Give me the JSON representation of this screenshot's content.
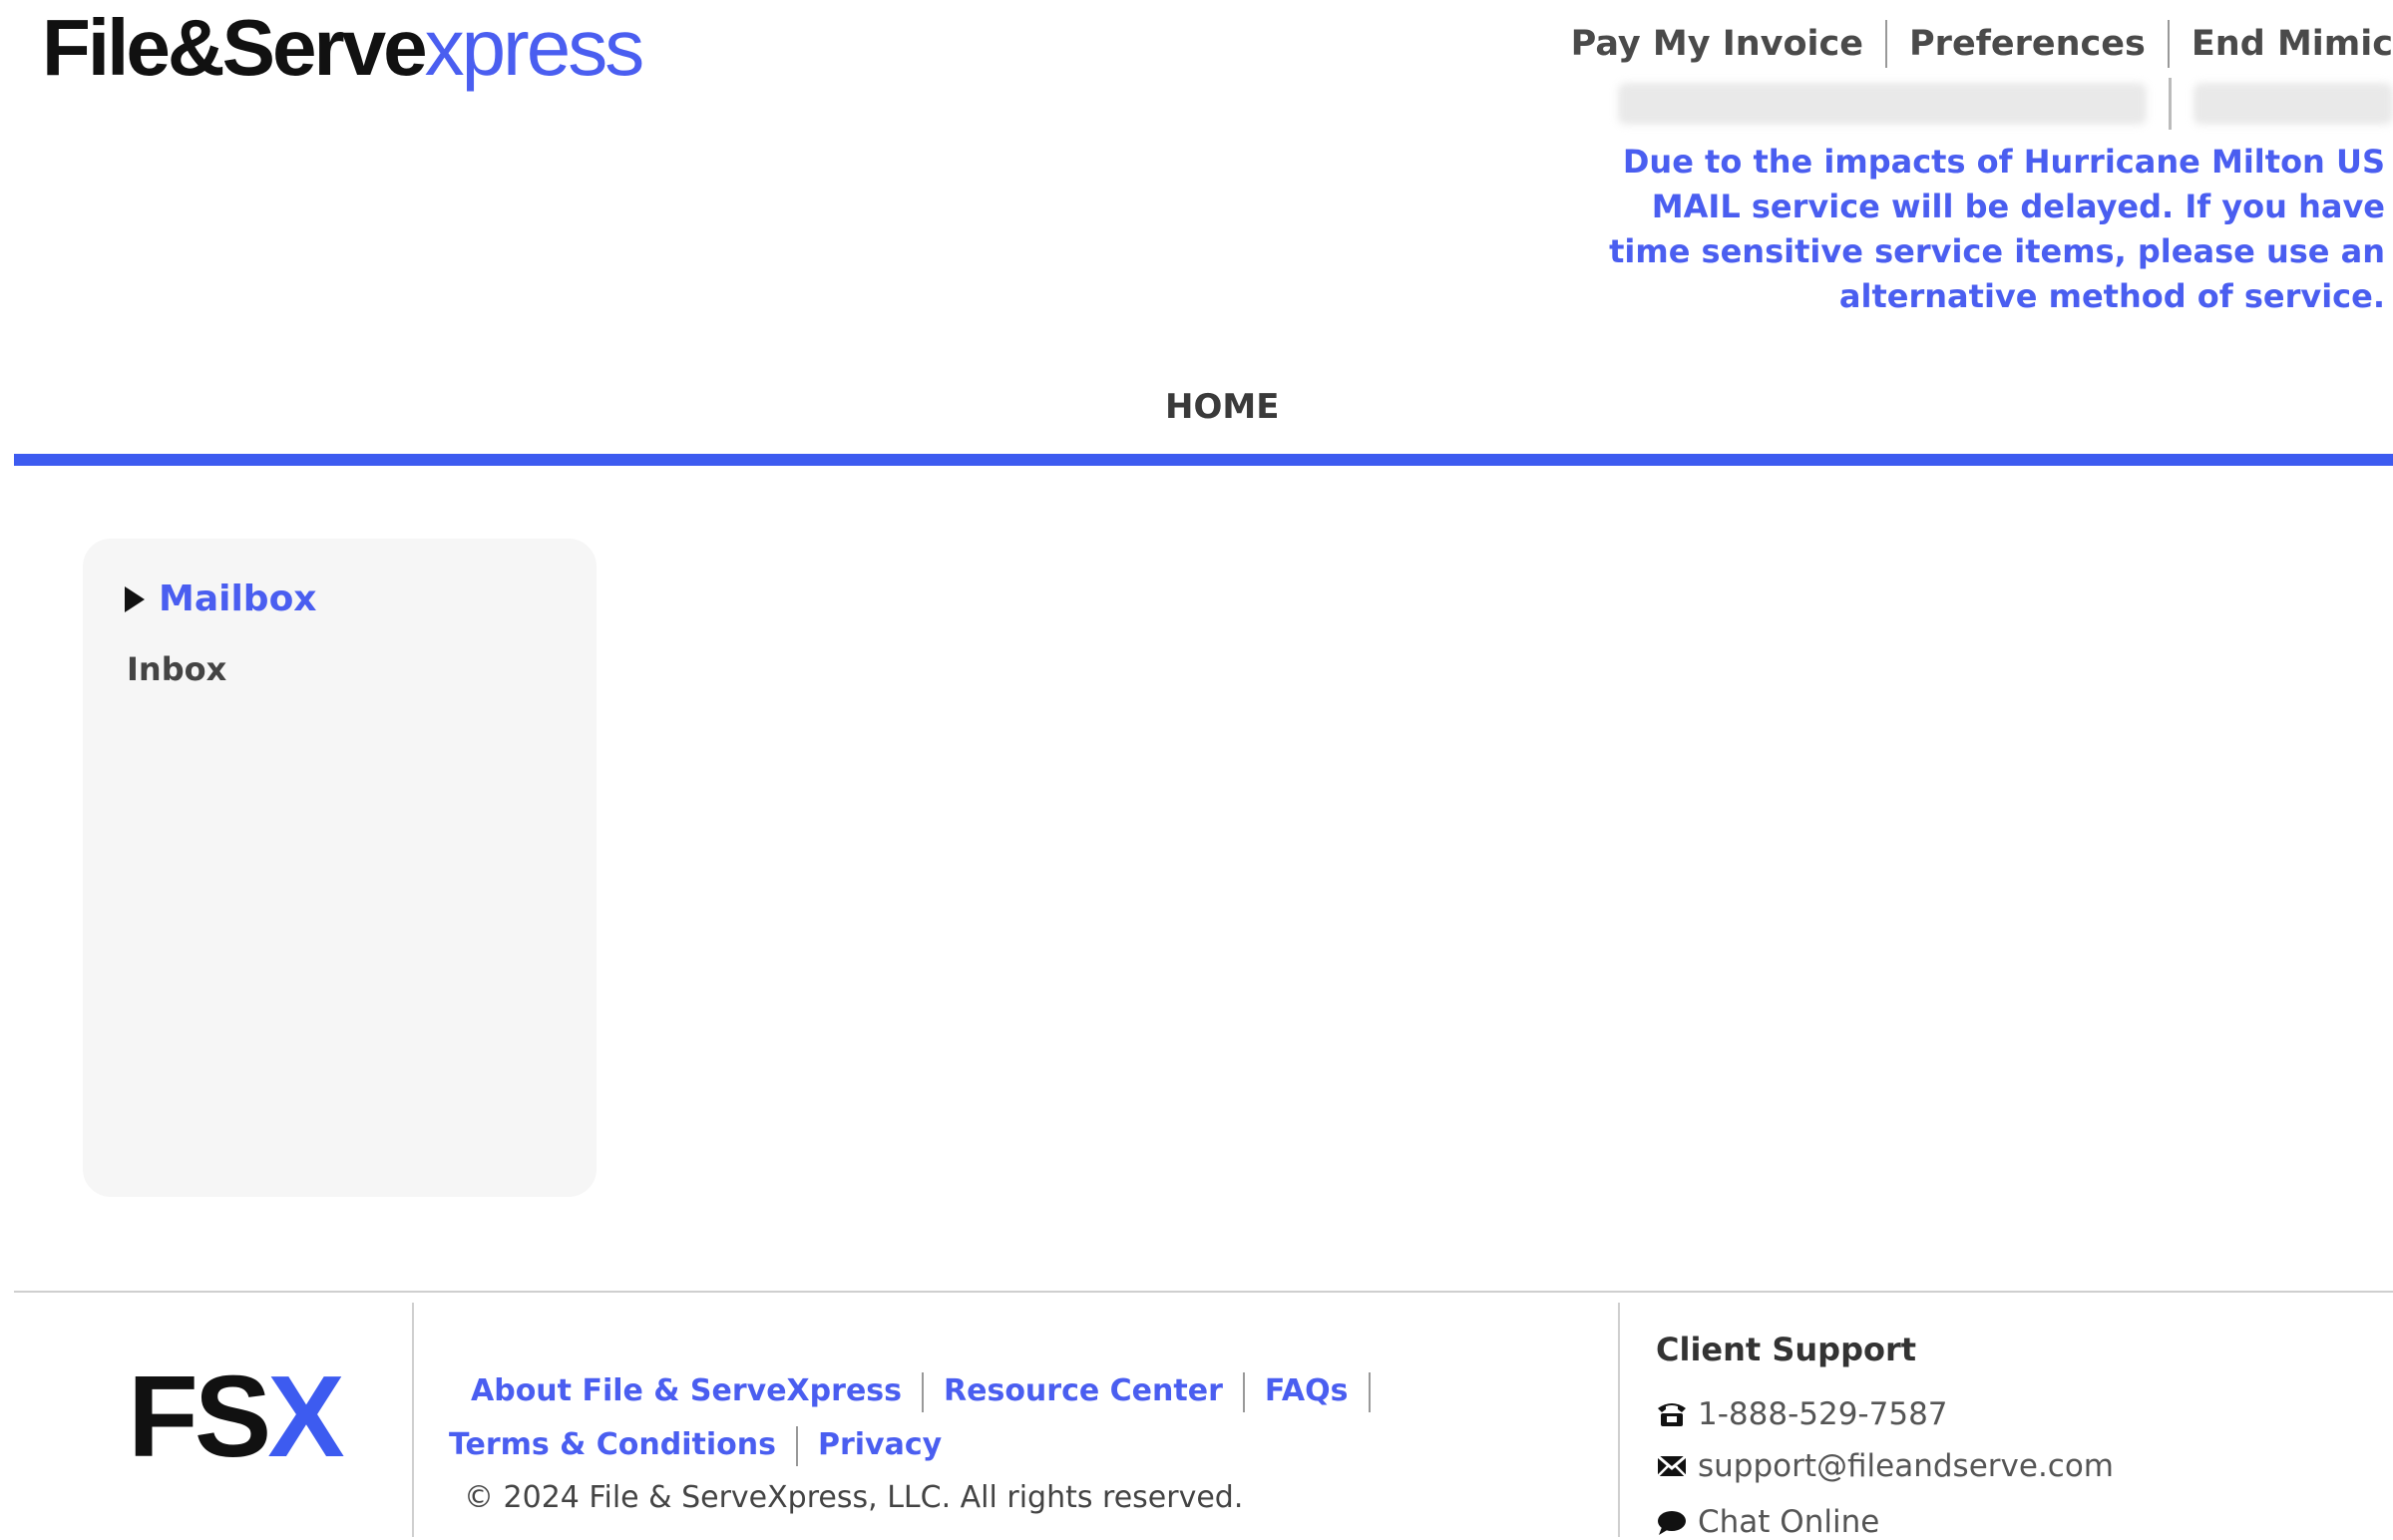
{
  "header": {
    "logo_main": "File&Serve",
    "logo_accent": "xpress",
    "links": [
      "Pay My Invoice",
      "Preferences",
      "End Mimic"
    ],
    "notice": "Due to the impacts of Hurricane Milton US MAIL service will be delayed. If you have time sensitive service items, please use an alternative method of service."
  },
  "nav": {
    "home": "HOME"
  },
  "sidebar": {
    "mailbox": "Mailbox",
    "inbox": "Inbox"
  },
  "footer": {
    "logo_main": "FS",
    "logo_accent": "X",
    "links": [
      "About File & ServeXpress",
      "Resource Center",
      "FAQs",
      "Terms & Conditions",
      "Privacy"
    ],
    "copyright": "© 2024 File & ServeXpress, LLC. All rights reserved.",
    "support": {
      "title": "Client Support",
      "phone": "1-888-529-7587",
      "email": "support@fileandserve.com",
      "chat": "Chat Online"
    }
  },
  "colors": {
    "accent": "#4a5ef0",
    "rule": "#3d5bf0",
    "panel": "#f6f6f6"
  }
}
